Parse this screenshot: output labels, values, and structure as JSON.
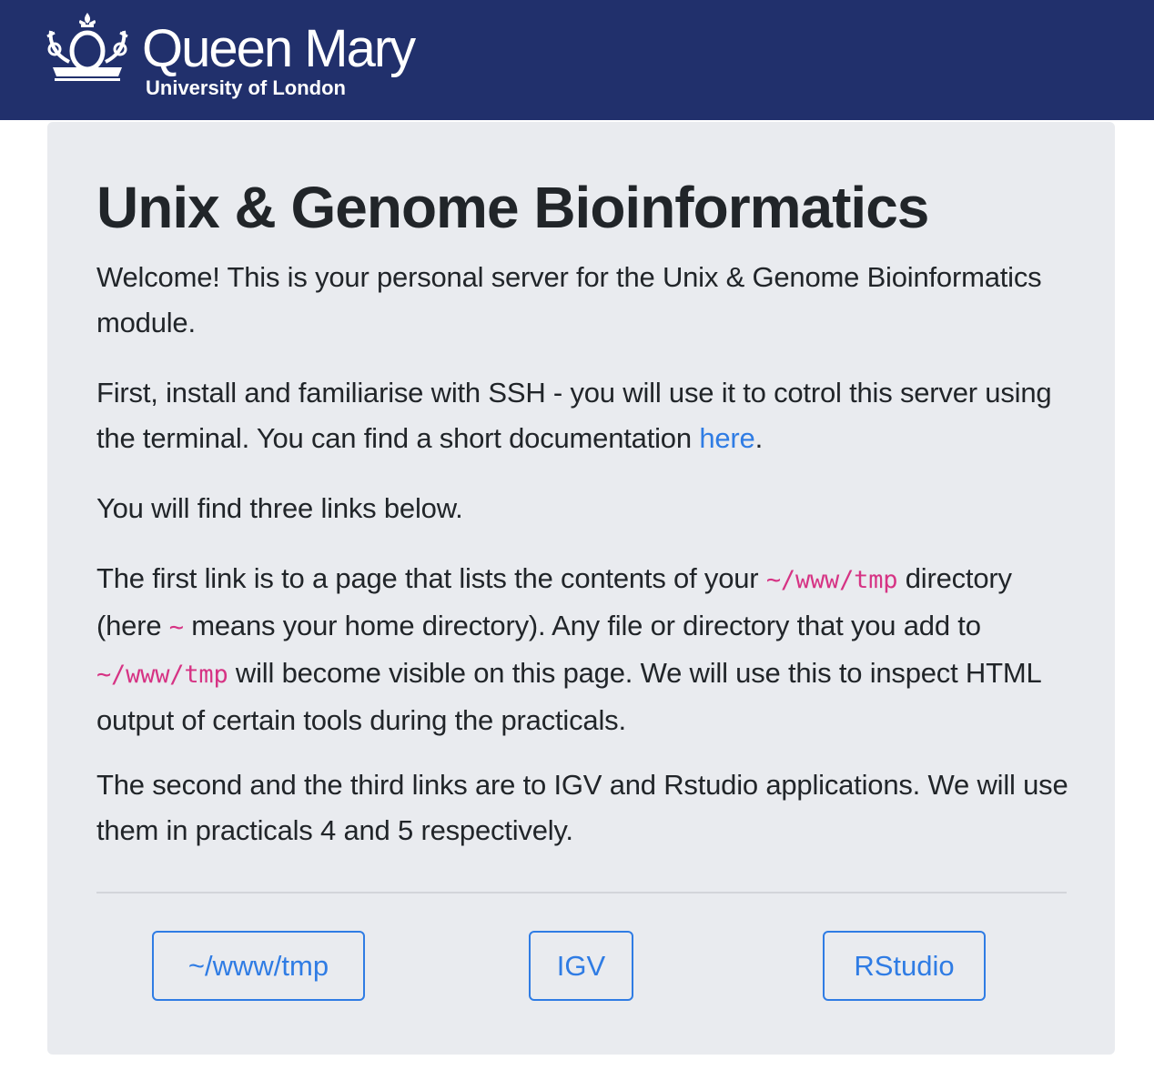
{
  "header": {
    "logo_name": "Queen Mary",
    "logo_sub": "University of London",
    "background_color": "#21306c"
  },
  "main": {
    "title": "Unix & Genome Bioinformatics",
    "p1": "Welcome! This is your personal server for the Unix & Genome Bioinformatics module.",
    "p2_before": "First, install and familiarise with SSH - you will use it to cotrol this server using the terminal. You can find a short documentation ",
    "p2_link": "here",
    "p2_after": ".",
    "p3": "You will find three links below.",
    "p4_a": "The first link is to a page that lists the contents of your ",
    "p4_code1": "~/www/tmp",
    "p4_b": " directory (here ",
    "p4_code2": "~",
    "p4_c": " means your home directory). Any file or directory that you add to ",
    "p4_code3": "~/www/tmp",
    "p4_d": " will become visible on this page. We will use this to inspect HTML output of certain tools during the practicals.",
    "p5": "The second and the third links are to IGV and Rstudio applications. We will use them in practicals 4 and 5 respectively."
  },
  "buttons": {
    "tmp": "~/www/tmp",
    "igv": "IGV",
    "rstudio": "RStudio"
  },
  "colors": {
    "accent": "#2f7ce4",
    "code": "#d63384",
    "panel": "#e9ebef"
  }
}
